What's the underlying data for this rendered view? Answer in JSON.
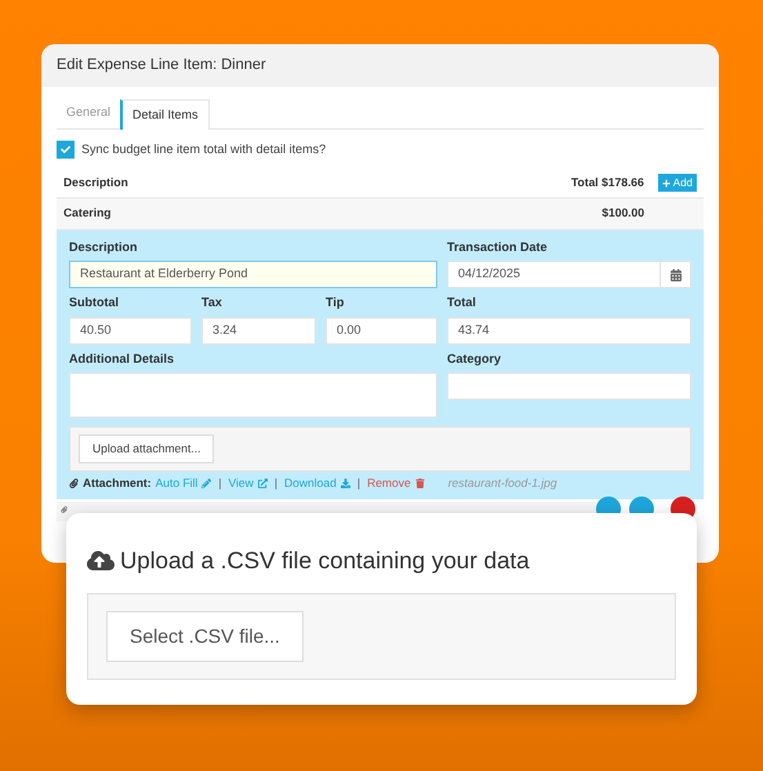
{
  "dialog": {
    "title": "Edit Expense Line Item: Dinner",
    "tabs": [
      {
        "label": "General",
        "selected": false
      },
      {
        "label": "Detail Items",
        "selected": true
      }
    ],
    "sync_checkbox": {
      "label": "Sync budget line item total with detail items?",
      "checked": true
    },
    "table": {
      "description_heading": "Description",
      "total": "Total $178.66",
      "add_button": "Add",
      "rows": [
        {
          "description": "Catering",
          "amount": "$100.00"
        }
      ]
    },
    "detail_form": {
      "rows": [
        [
          {
            "label": "Description",
            "value": "Restaurant at Elderberry Pond",
            "kind": "text",
            "focused": true
          },
          {
            "label": "Transaction Date",
            "value": "04/12/2025",
            "kind": "date",
            "focused": false
          }
        ],
        [
          {
            "label": "Subtotal",
            "value": "40.50",
            "kind": "text",
            "focused": false
          },
          {
            "label": "Tax",
            "value": "3.24",
            "kind": "text",
            "focused": false
          },
          {
            "label": "Tip",
            "value": "0.00",
            "kind": "text",
            "focused": false
          },
          {
            "label": "Total",
            "value": "43.74",
            "kind": "text",
            "focused": false
          }
        ],
        [
          {
            "label": "Additional Details",
            "kind": "textarea",
            "focused": false
          },
          {
            "label": "Category",
            "kind": "text",
            "focused": false
          }
        ]
      ],
      "upload_button": "Upload attachment...",
      "attachment": {
        "label": "Attachment:",
        "links": [
          {
            "text": "Auto Fill",
            "kind": "autofill"
          },
          {
            "text": "View",
            "kind": "view"
          },
          {
            "text": "Download",
            "kind": "download"
          },
          {
            "text": "Remove",
            "kind": "remove"
          }
        ],
        "separator": "|",
        "filename": "restaurant-food-1.jpg"
      }
    },
    "round_buttons": [
      {
        "kind": "primary"
      },
      {
        "kind": "primary"
      },
      {
        "kind": "danger"
      }
    ]
  },
  "upload_panel": {
    "title": "Upload a .CSV file containing your data",
    "button": "Select .CSV file..."
  }
}
